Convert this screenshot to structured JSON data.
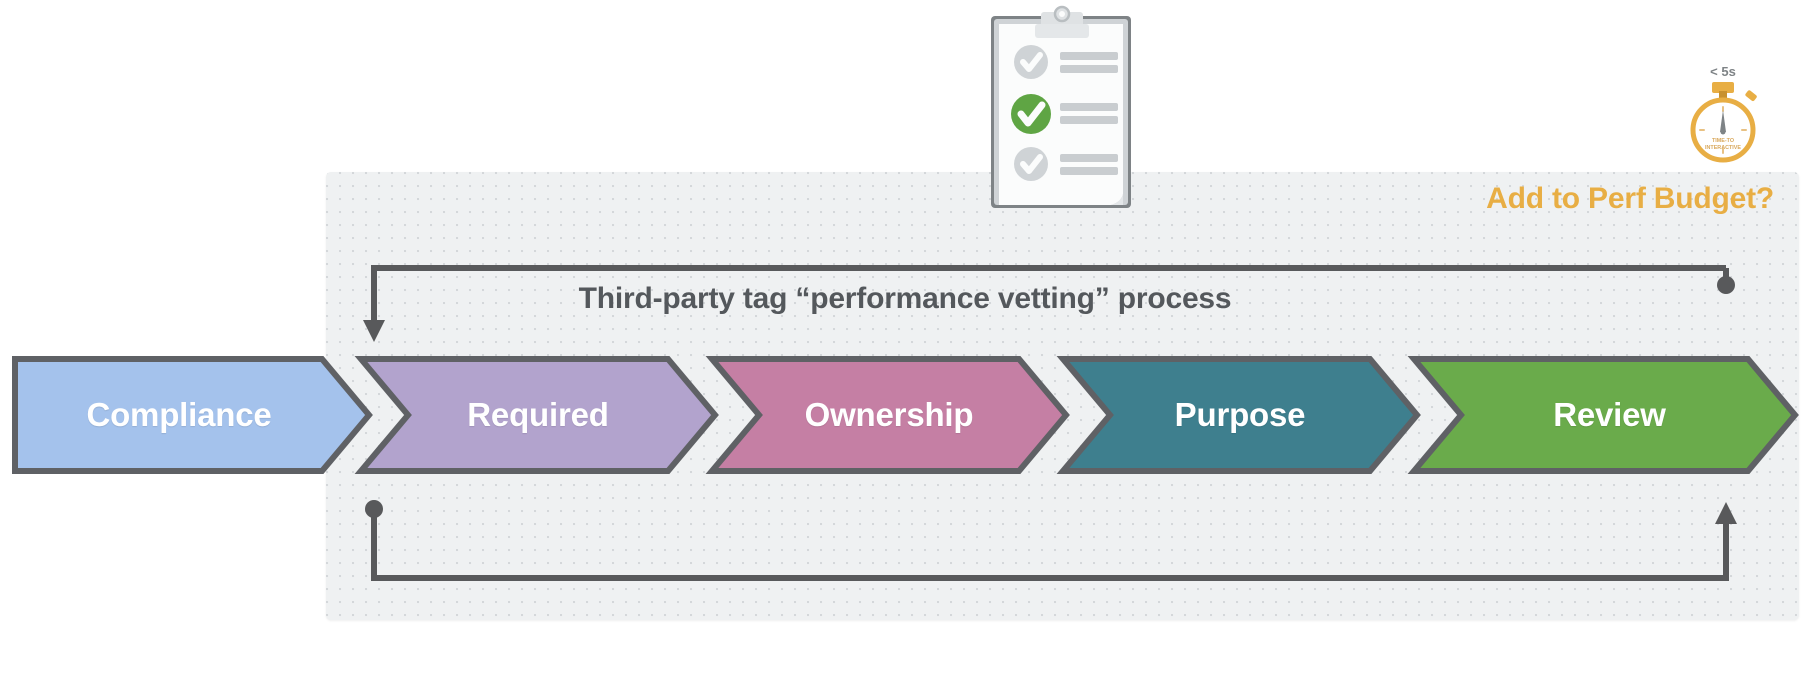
{
  "diagram": {
    "title": "Third-party tag “performance vetting” process",
    "perf_budget_label": "Add to Perf Budget?",
    "accent_color": "#e8ae44",
    "line_color": "#58595b",
    "panel_color": "#eff1f2",
    "title_color": "#54585c"
  },
  "stages": [
    {
      "label": "Compliance",
      "fill": "#a4c2ec",
      "stroke": "#5f6165"
    },
    {
      "label": "Required",
      "fill": "#b2a3cd",
      "stroke": "#5f6165"
    },
    {
      "label": "Ownership",
      "fill": "#c57fa4",
      "stroke": "#5f6165"
    },
    {
      "label": "Purpose",
      "fill": "#3e7f8e",
      "stroke": "#5f6165"
    },
    {
      "label": "Review",
      "fill": "#6aab4b",
      "stroke": "#5f6165"
    }
  ],
  "stopwatch": {
    "badge_label": "< 5s",
    "face_line_1": "TIME-TO",
    "face_line_2": "INTERACTIVE",
    "color": "#e8ae44"
  },
  "clipboard": {
    "items": [
      {
        "state": "unchecked",
        "check_color": "#cfd2d4"
      },
      {
        "state": "checked",
        "check_color": "#5fa544"
      },
      {
        "state": "unchecked",
        "check_color": "#cfd2d4"
      }
    ]
  },
  "connectors": [
    {
      "name": "top-feedback-loop",
      "start": "dot",
      "end": "arrow-down"
    },
    {
      "name": "bottom-feedback-loop",
      "start": "dot",
      "end": "arrow-up"
    }
  ]
}
